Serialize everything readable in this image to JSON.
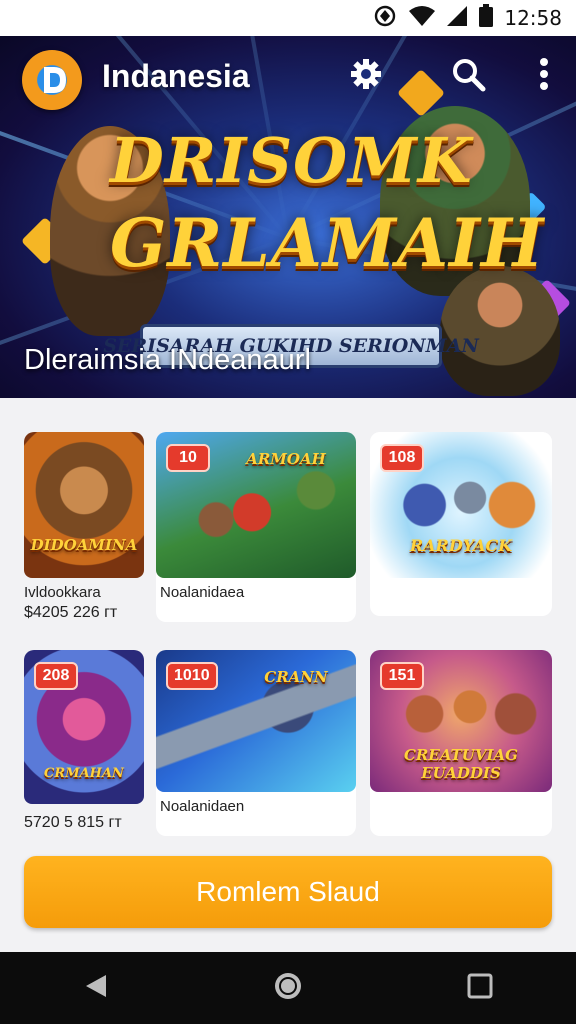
{
  "status_bar": {
    "time": "12:58"
  },
  "header": {
    "app_title": "Indanesia"
  },
  "banner": {
    "title_line1": "DRISOMK",
    "title_line2": "GRLAMAIH",
    "ribbon_text": "SERISARAH GUKIHD SERIONMAN",
    "subtitle": "Dleraimsia INdeanaurl"
  },
  "games": [
    {
      "badge": "",
      "logo": "DIDOAMINA",
      "name": "Ivldookkara",
      "price": "$4205 226 гт"
    },
    {
      "badge": "10",
      "logo": "ARMOAH",
      "name": "Noalanidaea",
      "price": ""
    },
    {
      "badge": "108",
      "logo": "RARDYACK",
      "name": "",
      "price": ""
    },
    {
      "badge": "208",
      "logo": "CRMAHAN",
      "name": "",
      "price": "5720 5 815 гт"
    },
    {
      "badge": "1010",
      "logo": "CRANN",
      "name": "Noalanidaen",
      "price": ""
    },
    {
      "badge": "151",
      "logo": "CREATUVIAG EUADDIS",
      "name": "",
      "price": ""
    }
  ],
  "cta": {
    "label": "Romlem Slaud"
  },
  "colors": {
    "accent": "#f59c0a",
    "badge": "#e53a2c",
    "hero_bg": "#1b2d7a"
  },
  "icons": [
    "signal-icon",
    "wifi-icon",
    "battery-icon",
    "settings-icon",
    "search-icon",
    "more-icon",
    "back-icon",
    "home-icon",
    "recents-icon"
  ]
}
